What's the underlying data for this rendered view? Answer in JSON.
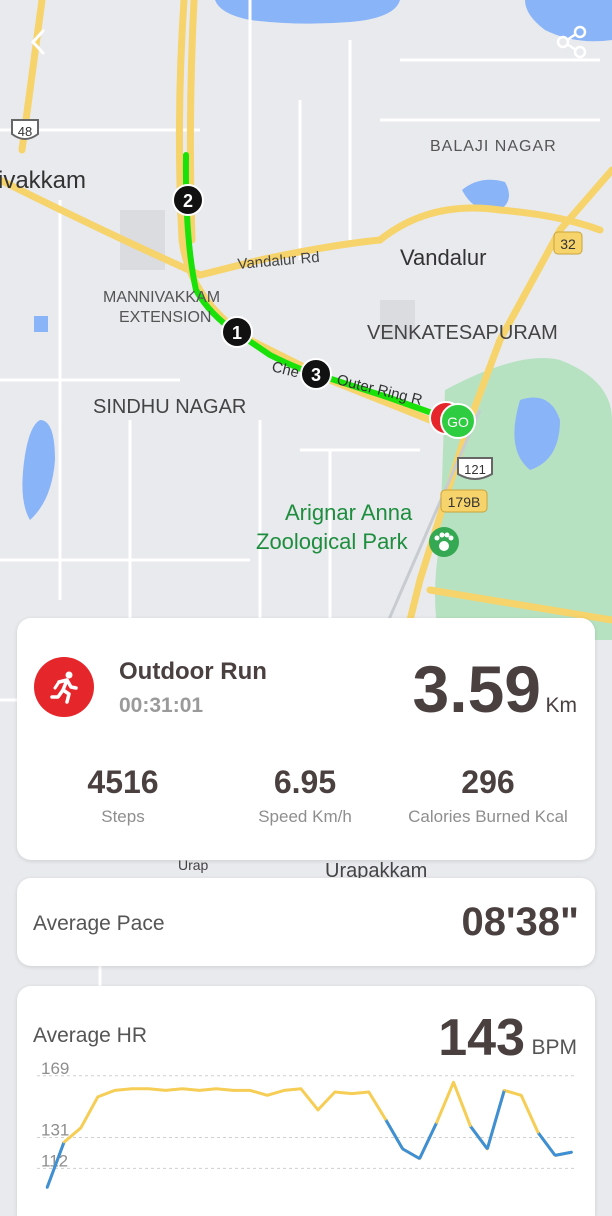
{
  "map": {
    "labels": {
      "area_west": "ivakkam",
      "balaji_nagar": "BALAJI NAGAR",
      "vandalur": "Vandalur",
      "vandalur_rd": "Vandalur Rd",
      "mannivakkam_1": "MANNIVAKKAM",
      "mannivakkam_2": "EXTENSION",
      "venkatesapuram": "VENKATESAPURAM",
      "sindhu_nagar": "SINDHU NAGAR",
      "ring_road_1": "Che",
      "ring_road_2": "Outer Ring R",
      "zoo_1": "Arignar Anna",
      "zoo_2": "Zoological Park",
      "urapakkam": "Urapakkam",
      "urap_small": "Urap",
      "hwy_48": "48",
      "hwy_32": "32",
      "hwy_121": "121",
      "hwy_179b": "179B",
      "go": "GO",
      "waypoint_1": "1",
      "waypoint_2": "2",
      "waypoint_3": "3"
    },
    "colors": {
      "route": "#1be10b",
      "road": "#f7d36b",
      "water": "#8ab4f8",
      "park": "#b7e2c2"
    }
  },
  "toolbar": {
    "back_icon": "chevron-left-icon",
    "share_icon": "share-icon"
  },
  "summary": {
    "activity_icon": "running-person-icon",
    "title": "Outdoor Run",
    "duration": "00:31:01",
    "distance": "3.59",
    "distance_unit": "Km",
    "stats": [
      {
        "value": "4516",
        "label": "Steps"
      },
      {
        "value": "6.95",
        "label": "Speed Km/h"
      },
      {
        "value": "296",
        "label": "Calories Burned Kcal"
      }
    ]
  },
  "pace": {
    "label": "Average Pace",
    "value": "08'38\""
  },
  "heart_rate": {
    "label": "Average HR",
    "value": "143",
    "unit": "BPM",
    "ticks": [
      "169",
      "131",
      "112"
    ]
  },
  "chart_data": {
    "type": "line",
    "title": "",
    "xlabel": "",
    "ylabel": "",
    "yticks": [
      169,
      131,
      112
    ],
    "ylim": [
      95,
      175
    ],
    "x": [
      0,
      1,
      2,
      3,
      4,
      5,
      6,
      7,
      8,
      9,
      10,
      11,
      12,
      13,
      14,
      15,
      16,
      17,
      18,
      19,
      20,
      21,
      22,
      23,
      24,
      25,
      26,
      27,
      28,
      29,
      30,
      31
    ],
    "series": [
      {
        "values": [
          100,
          128,
          137,
          156,
          160,
          161,
          161,
          160,
          161,
          160,
          161,
          160,
          160,
          157,
          160,
          161,
          148,
          159,
          158,
          159,
          142,
          124,
          118,
          140,
          165,
          138,
          124,
          160,
          157,
          134,
          120,
          122
        ]
      }
    ],
    "colors": {
      "line": "#f6cd55",
      "low": "#3d8fd6"
    }
  }
}
